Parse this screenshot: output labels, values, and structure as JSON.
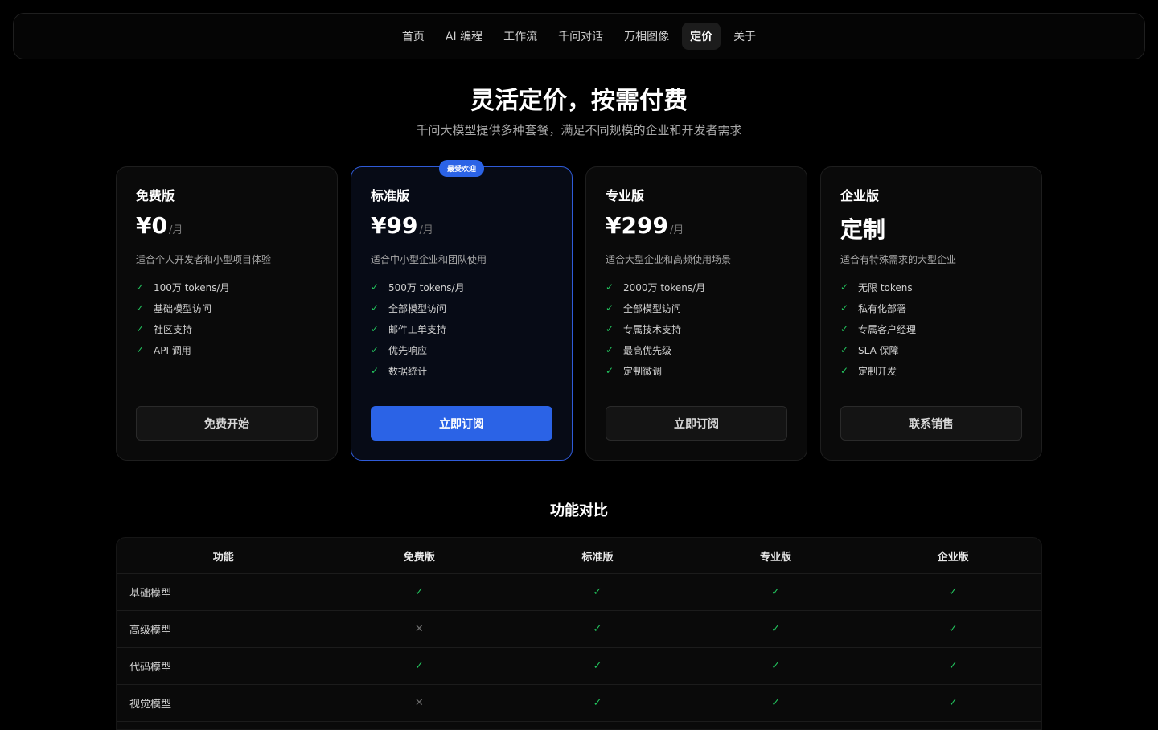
{
  "nav": {
    "items": [
      {
        "label": "首页",
        "active": false
      },
      {
        "label": "AI 编程",
        "active": false
      },
      {
        "label": "工作流",
        "active": false
      },
      {
        "label": "千问对话",
        "active": false
      },
      {
        "label": "万相图像",
        "active": false
      },
      {
        "label": "定价",
        "active": true
      },
      {
        "label": "关于",
        "active": false
      }
    ]
  },
  "hero": {
    "title": "灵活定价，按需付费",
    "subtitle": "千问大模型提供多种套餐，满足不同规模的企业和开发者需求"
  },
  "plans": [
    {
      "name": "免费版",
      "price": "¥0",
      "unit": "/月",
      "desc": "适合个人开发者和小型项目体验",
      "features": [
        "100万 tokens/月",
        "基础模型访问",
        "社区支持",
        "API 调用"
      ],
      "button": "免费开始",
      "featured": false
    },
    {
      "name": "标准版",
      "price": "¥99",
      "unit": "/月",
      "desc": "适合中小型企业和团队使用",
      "features": [
        "500万 tokens/月",
        "全部模型访问",
        "邮件工单支持",
        "优先响应",
        "数据统计"
      ],
      "button": "立即订阅",
      "featured": true,
      "badge": "最受欢迎"
    },
    {
      "name": "专业版",
      "price": "¥299",
      "unit": "/月",
      "desc": "适合大型企业和高频使用场景",
      "features": [
        "2000万 tokens/月",
        "全部模型访问",
        "专属技术支持",
        "最高优先级",
        "定制微调"
      ],
      "button": "立即订阅",
      "featured": false
    },
    {
      "name": "企业版",
      "price": "定制",
      "unit": "",
      "desc": "适合有特殊需求的大型企业",
      "features": [
        "无限 tokens",
        "私有化部署",
        "专属客户经理",
        "SLA 保障",
        "定制开发"
      ],
      "button": "联系销售",
      "featured": false
    }
  ],
  "comparison": {
    "title": "功能对比",
    "headers": [
      "功能",
      "免费版",
      "标准版",
      "专业版",
      "企业版"
    ],
    "rows": [
      {
        "feature": "基础模型",
        "values": [
          true,
          true,
          true,
          true
        ]
      },
      {
        "feature": "高级模型",
        "values": [
          false,
          true,
          true,
          true
        ]
      },
      {
        "feature": "代码模型",
        "values": [
          true,
          true,
          true,
          true
        ]
      },
      {
        "feature": "视觉模型",
        "values": [
          false,
          true,
          true,
          true
        ]
      },
      {
        "feature": "",
        "values": []
      }
    ]
  },
  "icons": {
    "check": "check-icon",
    "cross": "cross-icon"
  },
  "colors": {
    "accent": "#2b63e6",
    "check": "#22c55e",
    "background": "#000000"
  }
}
